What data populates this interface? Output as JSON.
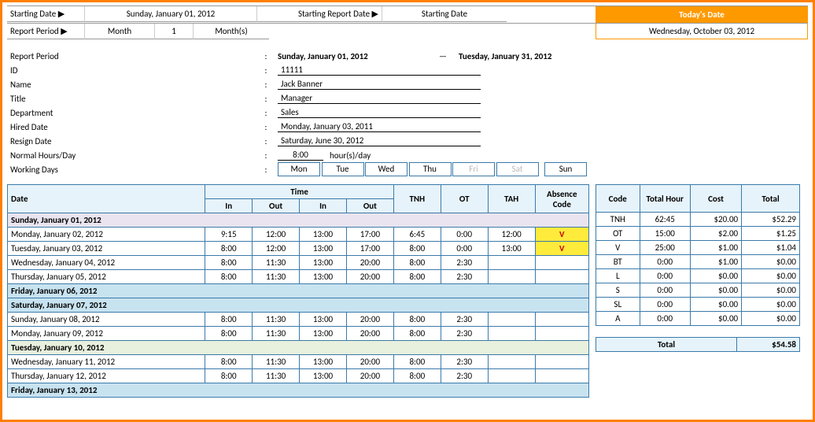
{
  "header": {
    "starting_date_label": "Starting Date ▶",
    "starting_date_value": "Sunday, January 01, 2012",
    "starting_report_label": "Starting Report Date ▶",
    "starting_report_value": "Starting Date",
    "todays_date_label": "Today's Date",
    "todays_date_value": "Wednesday, October 03, 2012",
    "report_period_label": "Report Period ▶",
    "report_period_unit": "Month",
    "report_period_qty": "1",
    "report_period_suffix": "Month(s)"
  },
  "info": {
    "report_period_label": "Report Period",
    "report_period_from": "Sunday, January 01, 2012",
    "report_period_dash": "—",
    "report_period_to": "Tuesday, January 31, 2012",
    "id_label": "ID",
    "id_value": "11111",
    "name_label": "Name",
    "name_value": "Jack Banner",
    "title_label": "Title",
    "title_value": "Manager",
    "dept_label": "Department",
    "dept_value": "Sales",
    "hired_label": "Hired Date",
    "hired_value": "Monday, January 03, 2011",
    "resign_label": "Resign Date",
    "resign_value": "Saturday, June 30, 2012",
    "normal_label": "Normal Hours/Day",
    "normal_value": "8:00",
    "normal_suffix": "hour(s)/day",
    "working_label": "Working Days",
    "days": {
      "mon": "Mon",
      "tue": "Tue",
      "wed": "Wed",
      "thu": "Thu",
      "fri": "Fri",
      "sat": "Sat",
      "sun": "Sun"
    }
  },
  "main_headers": {
    "date": "Date",
    "time": "Time",
    "in": "In",
    "out": "Out",
    "tnh": "TNH",
    "ot": "OT",
    "tah": "TAH",
    "abs": "Absence Code"
  },
  "rows": [
    {
      "date": "Sunday, January 01, 2012",
      "cls": "sunday"
    },
    {
      "date": "Monday, January 02, 2012",
      "in1": "9:15",
      "out1": "12:00",
      "in2": "13:00",
      "out2": "17:00",
      "tnh": "6:45",
      "ot": "0:00",
      "tah": "12:00",
      "abs": "V"
    },
    {
      "date": "Tuesday, January 03, 2012",
      "in1": "8:00",
      "out1": "12:00",
      "in2": "13:00",
      "out2": "17:00",
      "tnh": "8:00",
      "ot": "0:00",
      "tah": "13:00",
      "abs": "V"
    },
    {
      "date": "Wednesday, January 04, 2012",
      "in1": "8:00",
      "out1": "11:30",
      "in2": "13:00",
      "out2": "20:00",
      "tnh": "8:00",
      "ot": "2:30"
    },
    {
      "date": "Thursday, January 05, 2012",
      "in1": "8:00",
      "out1": "11:30",
      "in2": "13:00",
      "out2": "20:00",
      "tnh": "8:00",
      "ot": "2:30"
    },
    {
      "date": "Friday, January 06, 2012",
      "cls": "friday"
    },
    {
      "date": "Saturday, January 07, 2012",
      "cls": "saturday"
    },
    {
      "date": "Sunday, January 08, 2012",
      "in1": "8:00",
      "out1": "11:30",
      "in2": "13:00",
      "out2": "20:00",
      "tnh": "8:00",
      "ot": "2:30"
    },
    {
      "date": "Monday, January 09, 2012",
      "in1": "8:00",
      "out1": "11:30",
      "in2": "13:00",
      "out2": "20:00",
      "tnh": "8:00",
      "ot": "2:30"
    },
    {
      "date": "Tuesday, January 10, 2012",
      "cls": "tuesday"
    },
    {
      "date": "Wednesday, January 11, 2012",
      "in1": "8:00",
      "out1": "11:30",
      "in2": "13:00",
      "out2": "20:00",
      "tnh": "8:00",
      "ot": "2:30"
    },
    {
      "date": "Thursday, January 12, 2012",
      "in1": "8:00",
      "out1": "11:30",
      "in2": "13:00",
      "out2": "20:00",
      "tnh": "8:00",
      "ot": "2:30"
    },
    {
      "date": "Friday, January 13, 2012",
      "cls": "friday"
    }
  ],
  "summary_headers": {
    "code": "Code",
    "hour": "Total Hour",
    "cost": "Cost",
    "total": "Total"
  },
  "summary": [
    {
      "code": "TNH",
      "hour": "62:45",
      "cost": "$20.00",
      "total": "$52.29"
    },
    {
      "code": "OT",
      "hour": "15:00",
      "cost": "$2.00",
      "total": "$1.25"
    },
    {
      "code": "V",
      "hour": "25:00",
      "cost": "$1.00",
      "total": "$1.04"
    },
    {
      "code": "BT",
      "hour": "0:00",
      "cost": "$1.00",
      "total": "$0.00"
    },
    {
      "code": "L",
      "hour": "0:00",
      "cost": "$0.00",
      "total": "$0.00"
    },
    {
      "code": "S",
      "hour": "0:00",
      "cost": "$0.00",
      "total": "$0.00"
    },
    {
      "code": "SL",
      "hour": "0:00",
      "cost": "$0.00",
      "total": "$0.00"
    },
    {
      "code": "A",
      "hour": "0:00",
      "cost": "$0.00",
      "total": "$0.00"
    }
  ],
  "grand_total": {
    "label": "Total",
    "value": "$54.58"
  }
}
